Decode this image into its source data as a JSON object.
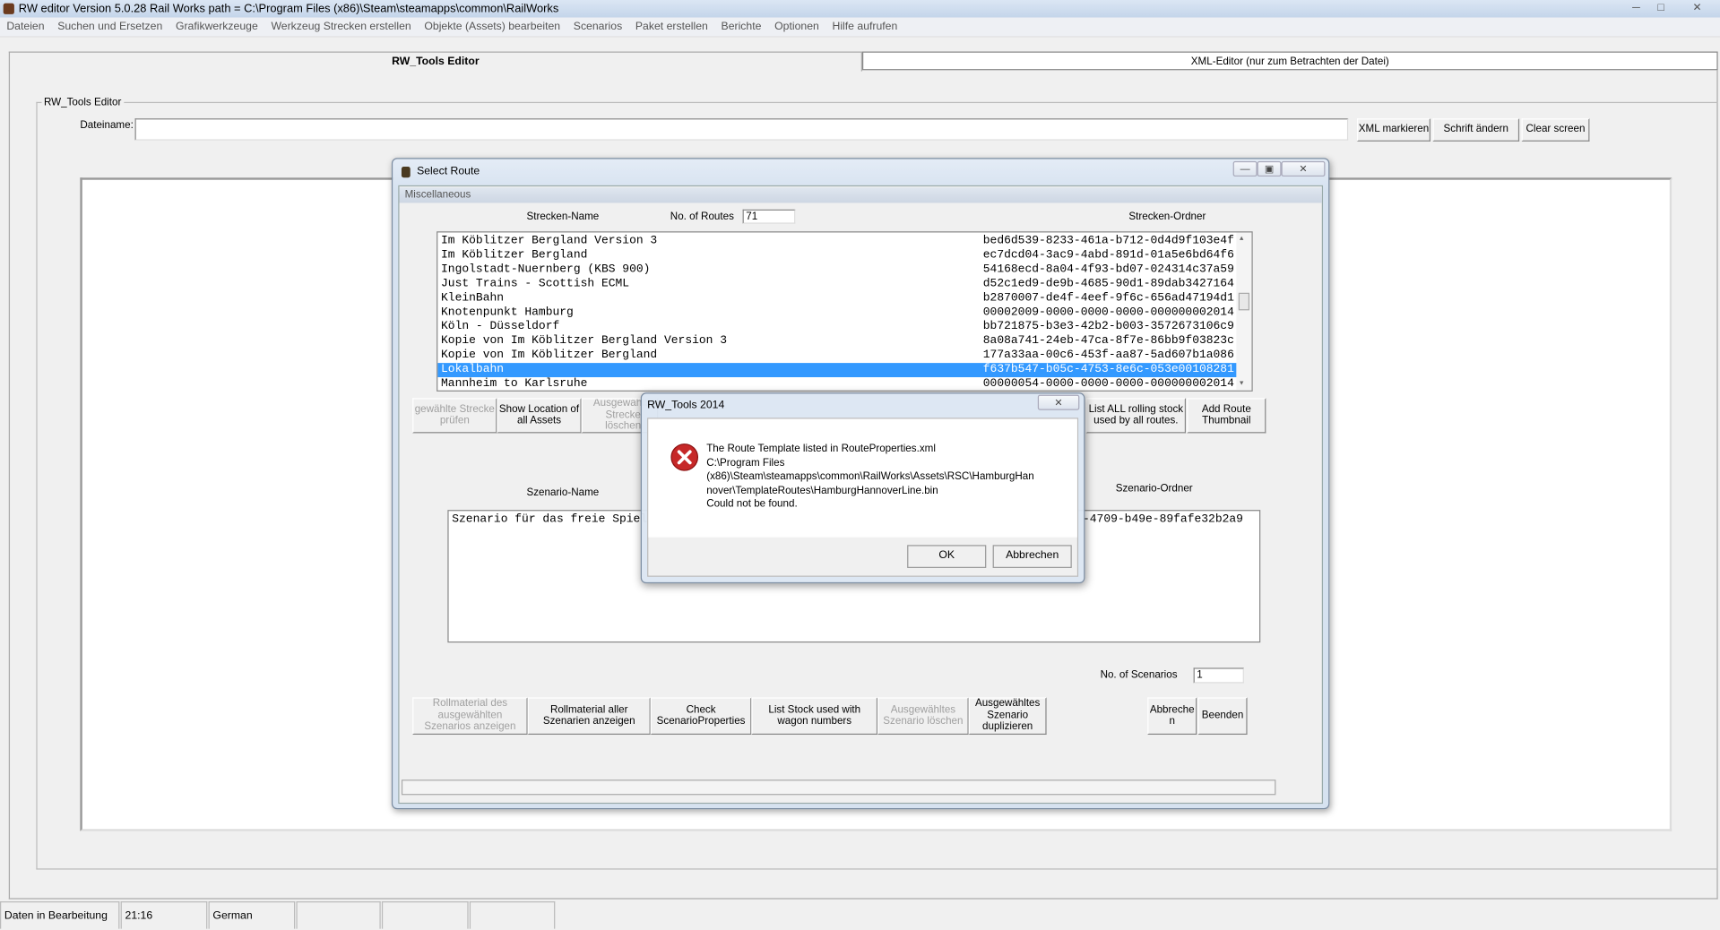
{
  "app": {
    "title": "RW editor  Version 5.0.28   Rail Works path = C:\\Program Files (x86)\\Steam\\steamapps\\common\\RailWorks"
  },
  "menu": [
    "Dateien",
    "Suchen und Ersetzen",
    "Grafikwerkzeuge",
    "Werkzeug Strecken erstellen",
    "Objekte (Assets) bearbeiten",
    "Scenarios",
    "Paket erstellen",
    "Berichte",
    "Optionen",
    "Hilfe aufrufen"
  ],
  "tabs": [
    {
      "label": "RW_Tools Editor",
      "active": true
    },
    {
      "label": "XML-Editor (nur zum Betrachten der Datei)",
      "active": false
    }
  ],
  "editor": {
    "group_label": "RW_Tools Editor",
    "filename_label": "Dateiname:",
    "filename_value": "",
    "xml_button": "XML markieren",
    "font_button": "Schrift ändern",
    "clear_button": "Clear screen"
  },
  "select_route": {
    "title": "Select Route",
    "section": "Miscellaneous",
    "col_name": "Strecken-Name",
    "routes_label": "No. of Routes",
    "routes_count": "71",
    "col_folder": "Strecken-Ordner",
    "routes": [
      {
        "name": "Im Köblitzer Bergland Version 3",
        "guid": "bed6d539-8233-461a-b712-0d4d9f103e4f"
      },
      {
        "name": "Im Köblitzer Bergland",
        "guid": "ec7dcd04-3ac9-4abd-891d-01a5e6bd64f6"
      },
      {
        "name": "Ingolstadt-Nuernberg (KBS 900)",
        "guid": "54168ecd-8a04-4f93-bd07-024314c37a59"
      },
      {
        "name": "Just Trains - Scottish ECML",
        "guid": "d52c1ed9-de9b-4685-90d1-89dab3427164"
      },
      {
        "name": "KleinBahn",
        "guid": "b2870007-de4f-4eef-9f6c-656ad47194d1"
      },
      {
        "name": "Knotenpunkt Hamburg",
        "guid": "00002009-0000-0000-0000-000000002014"
      },
      {
        "name": "Köln - Düsseldorf",
        "guid": "bb721875-b3e3-42b2-b003-3572673106c9"
      },
      {
        "name": "Kopie von Im Köblitzer Bergland Version 3",
        "guid": "8a08a741-24eb-47ca-8f7e-86bb9f03823c"
      },
      {
        "name": "Kopie von Im Köblitzer Bergland",
        "guid": "177a33aa-00c6-453f-aa87-5ad607b1a086"
      },
      {
        "name": "Lokalbahn",
        "guid": "f637b547-b05c-4753-8e6c-053e00108281",
        "selected": true
      },
      {
        "name": "Mannheim to Karlsruhe",
        "guid": "00000054-0000-0000-0000-000000002014"
      }
    ],
    "route_buttons": {
      "check": "gewählte Strecke prüfen",
      "show_location": "Show Location of all Assets",
      "delete": "Ausgewählte Strecke löschen",
      "list_all": "List ALL rolling stock used by all routes.",
      "thumbnail": "Add Route Thumbnail"
    },
    "scn_col_name": "Szenario-Name",
    "scn_col_folder": "Szenario-Ordner",
    "scenarios": [
      {
        "name": "Szenario für das freie Spiel",
        "guid": "-4709-b49e-89fafe32b2a9"
      }
    ],
    "scenarios_label": "No. of Scenarios",
    "scenarios_count": "1",
    "scn_buttons": {
      "stock_selected": "Rollmaterial des ausgewählten Szenarios anzeigen",
      "stock_all": "Rollmaterial aller Szenarien anzeigen",
      "check_props": "Check ScenarioProperties",
      "list_stock": "List Stock used with wagon numbers",
      "delete": "Ausgewähltes Szenario löschen",
      "duplicate": "Ausgewähltes Szenario duplizieren",
      "cancel": "Abbrechen",
      "quit": "Beenden"
    }
  },
  "dialog": {
    "title": "RW_Tools 2014",
    "icon": "error-icon",
    "lines": [
      "The Route Template listed in RouteProperties.xml",
      "C:\\Program Files",
      "(x86)\\Steam\\steamapps\\common\\RailWorks\\Assets\\RSC\\HamburgHan",
      "nover\\TemplateRoutes\\HamburgHannoverLine.bin",
      "Could not be found."
    ],
    "ok": "OK",
    "cancel": "Abbrechen"
  },
  "statusbar": [
    "Daten in Bearbeitung",
    "21:16",
    "German",
    "",
    "",
    ""
  ]
}
